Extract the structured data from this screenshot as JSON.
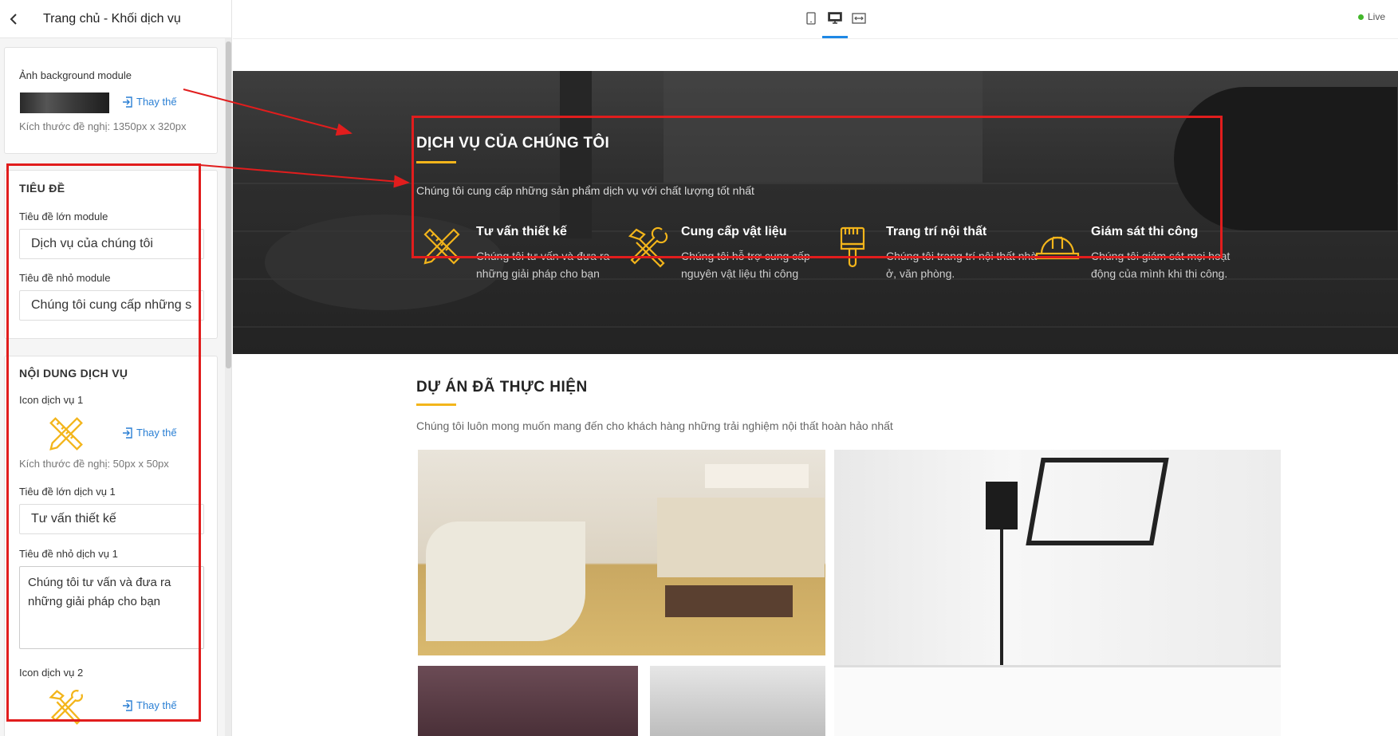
{
  "sidebar": {
    "title": "Trang chủ - Khối dịch vụ",
    "background": {
      "label": "Ảnh background module",
      "replace_label": "Thay thế",
      "hint": "Kích thước đề nghị: 1350px x 320px"
    },
    "heading_section": {
      "title": "TIÊU ĐỀ",
      "big_title_label": "Tiêu đề lớn module",
      "big_title_value": "Dịch vụ của chúng tôi",
      "small_title_label": "Tiêu đề nhỏ module",
      "small_title_value": "Chúng tôi cung cấp những sản phẩm dịch vụ với chất lượng tốt nhất"
    },
    "content_section": {
      "title": "NỘI DUNG DỊCH VỤ",
      "icon1_label": "Icon dịch vụ 1",
      "replace_label": "Thay thế",
      "icon_hint": "Kích thước đề nghị: 50px x 50px",
      "service1_big_label": "Tiêu đề lớn dịch vụ 1",
      "service1_big_value": "Tư vấn thiết kế",
      "service1_small_label": "Tiêu đề nhỏ dịch vụ 1",
      "service1_small_value": "Chúng tôi tư vấn và đưa ra những giải pháp cho bạn",
      "icon2_label": "Icon dịch vụ 2"
    }
  },
  "toolbar": {
    "live_label": "Live",
    "devices": [
      "mobile-icon",
      "desktop-icon",
      "fullwidth-icon"
    ],
    "accent": "#1e88e5"
  },
  "preview": {
    "services": {
      "title": "DỊCH VỤ CỦA CHÚNG TÔI",
      "subtitle": "Chúng tôi cung cấp những sản phẩm dịch vụ với chất lượng tốt nhất",
      "items": [
        {
          "title": "Tư vấn thiết kế",
          "desc": "Chúng tôi tư vấn và đưa ra những giải pháp cho bạn",
          "icon": "ruler-pencil-icon"
        },
        {
          "title": "Cung cấp vật liệu",
          "desc": "Chúng tôi hỗ trợ cung cấp nguyên vật liệu thi công",
          "icon": "hammer-wrench-icon"
        },
        {
          "title": "Trang trí nội thất",
          "desc": "Chúng tôi trang trí nội thất nhà ở, văn phòng.",
          "icon": "paint-brush-icon"
        },
        {
          "title": "Giám sát thi công",
          "desc": "Chúng tôi giám sát mọi hoạt động của mình khi thi công.",
          "icon": "hard-hat-icon"
        }
      ]
    },
    "projects": {
      "title": "DỰ ÁN ĐÃ THỰC HIỆN",
      "subtitle": "Chúng tôi luôn mong muốn mang đến cho khách hàng những trải nghiệm nội thất hoàn hảo nhất"
    }
  },
  "colors": {
    "accent_yellow": "#f3b51b",
    "annotation_red": "#e11d1d",
    "link_blue": "#2a7fd4"
  }
}
